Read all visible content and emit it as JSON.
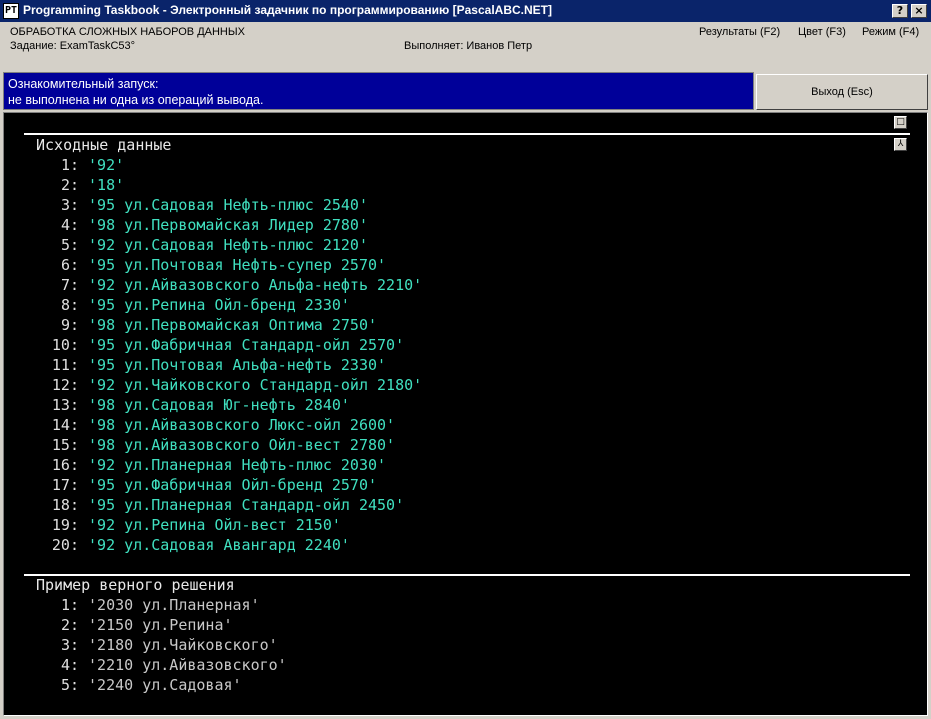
{
  "window": {
    "title": "Programming Taskbook - Электронный задачник по программированию [PascalABC.NET]",
    "icon_text": "PT",
    "help_label": "?",
    "close_label": "×"
  },
  "header": {
    "section": "ОБРАБОТКА СЛОЖНЫХ НАБОРОВ ДАННЫХ",
    "task": "Задание: ExamTaskC53°",
    "performer": "Выполняет: Иванов Петр",
    "results_label": "Результаты (F2)",
    "color_label": "Цвет (F3)",
    "mode_label": "Режим (F4)"
  },
  "message": {
    "line1": "Ознакомительный запуск:",
    "line2": " не выполнена ни одна из операций вывода."
  },
  "exit_label": "Выход (Esc)",
  "console": {
    "mini_btn1": "□",
    "mini_btn2": "⅄",
    "input_title": "Исходные данные",
    "input_items": [
      {
        "n": "1:",
        "v": "'92'"
      },
      {
        "n": "2:",
        "v": "'18'"
      },
      {
        "n": "3:",
        "v": "'95 ул.Садовая Нефть-плюс 2540'"
      },
      {
        "n": "4:",
        "v": "'98 ул.Первомайская Лидер 2780'"
      },
      {
        "n": "5:",
        "v": "'92 ул.Садовая Нефть-плюс 2120'"
      },
      {
        "n": "6:",
        "v": "'95 ул.Почтовая Нефть-супер 2570'"
      },
      {
        "n": "7:",
        "v": "'92 ул.Айвазовского Альфа-нефть 2210'"
      },
      {
        "n": "8:",
        "v": "'95 ул.Репина Ойл-бренд 2330'"
      },
      {
        "n": "9:",
        "v": "'98 ул.Первомайская Оптима 2750'"
      },
      {
        "n": "10:",
        "v": "'95 ул.Фабричная Стандард-ойл 2570'"
      },
      {
        "n": "11:",
        "v": "'95 ул.Почтовая Альфа-нефть 2330'"
      },
      {
        "n": "12:",
        "v": "'92 ул.Чайковского Стандард-ойл 2180'"
      },
      {
        "n": "13:",
        "v": "'98 ул.Садовая Юг-нефть 2840'"
      },
      {
        "n": "14:",
        "v": "'98 ул.Айвазовского Люкс-ойл 2600'"
      },
      {
        "n": "15:",
        "v": "'98 ул.Айвазовского Ойл-вест 2780'"
      },
      {
        "n": "16:",
        "v": "'92 ул.Планерная Нефть-плюс 2030'"
      },
      {
        "n": "17:",
        "v": "'95 ул.Фабричная Ойл-бренд 2570'"
      },
      {
        "n": "18:",
        "v": "'95 ул.Планерная Стандард-ойл 2450'"
      },
      {
        "n": "19:",
        "v": "'92 ул.Репина Ойл-вест 2150'"
      },
      {
        "n": "20:",
        "v": "'92 ул.Садовая Авангард 2240'"
      }
    ],
    "output_title": "Пример верного решения",
    "output_items": [
      {
        "n": "1:",
        "v": "'2030 ул.Планерная'"
      },
      {
        "n": "2:",
        "v": "'2150 ул.Репина'"
      },
      {
        "n": "3:",
        "v": "'2180 ул.Чайковского'"
      },
      {
        "n": "4:",
        "v": "'2210 ул.Айвазовского'"
      },
      {
        "n": "5:",
        "v": "'2240 ул.Садовая'"
      }
    ]
  }
}
